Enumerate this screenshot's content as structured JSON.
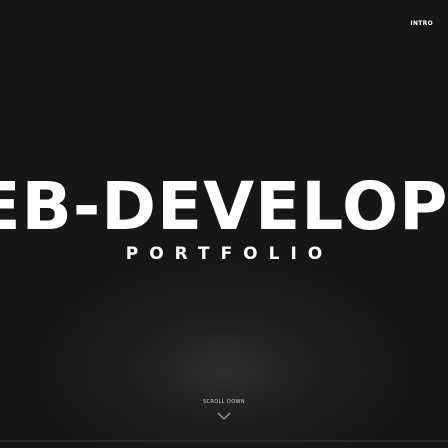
{
  "nav": {
    "intro_label": "INTRO"
  },
  "hero": {
    "title": "WEB-DEVELOPER",
    "subtitle": "PORTFOLIO"
  },
  "scroll": {
    "label": "SCROLL DOWN",
    "icon": "chevron-down-icon"
  },
  "colors": {
    "background": "#161616",
    "text": "#ffffff",
    "muted_text": "#cfcfcf"
  }
}
